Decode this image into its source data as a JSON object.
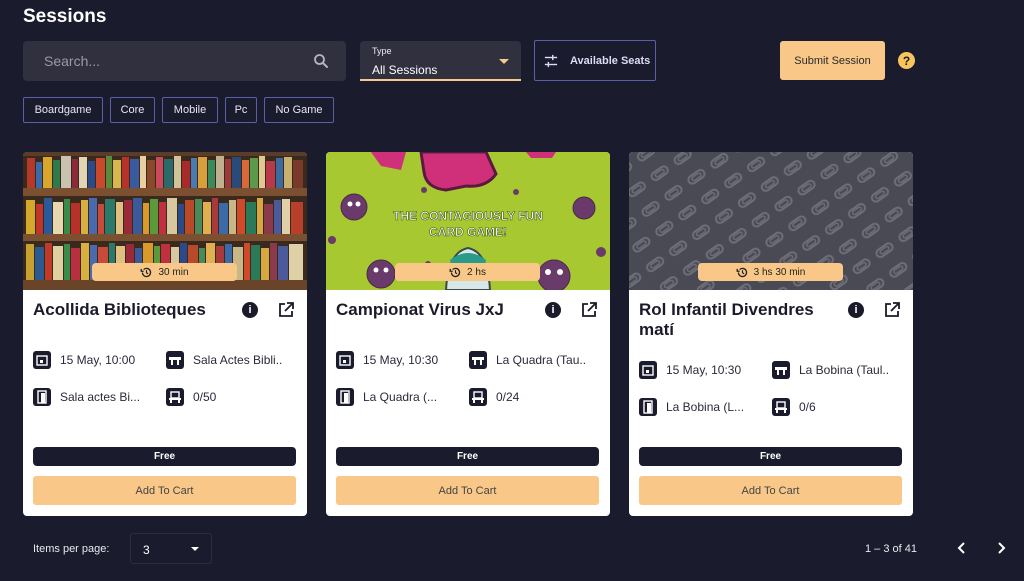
{
  "header": {
    "title": "Sessions"
  },
  "search": {
    "placeholder": "Search..."
  },
  "type_filter": {
    "label": "Type",
    "value": "All Sessions"
  },
  "seats_button": {
    "label": "Available Seats"
  },
  "submit_button": {
    "label": "Submit Session"
  },
  "help": {
    "glyph": "?"
  },
  "chips": [
    {
      "label": "Boardgame"
    },
    {
      "label": "Core"
    },
    {
      "label": "Mobile"
    },
    {
      "label": "Pc"
    },
    {
      "label": "No Game"
    }
  ],
  "cards": [
    {
      "image": "bookshelf-library",
      "duration": "30 min",
      "title": "Acollida Biblioteques",
      "date": "15 May, 10:00",
      "room": "Sala Actes Bibli...",
      "location": "Sala actes Bi...",
      "seats": "0/50",
      "price": "Free",
      "cart_label": "Add To Cart"
    },
    {
      "image": "virus-card-game",
      "image_text": "THE CONTAGIOUSLY FUN CARD GAME!",
      "duration": "2 hs",
      "title": "Campionat Virus JxJ",
      "date": "15 May, 10:30",
      "room": "La Quadra (Tau...",
      "location": "La Quadra (...",
      "seats": "0/24",
      "price": "Free",
      "cart_label": "Add To Cart"
    },
    {
      "image": "paperclip-pattern",
      "duration": "3 hs 30 min",
      "title": "Rol Infantil Divendres matí",
      "date": "15 May, 10:30",
      "room": "La Bobina (Taul...",
      "location": "La Bobina (L...",
      "seats": "0/6",
      "price": "Free",
      "cart_label": "Add To Cart"
    }
  ],
  "pagination": {
    "items_per_page_label": "Items per page:",
    "items_per_page": "3",
    "range": "1 – 3 of 41"
  },
  "colors": {
    "background": "#1b1b2e",
    "accent": "#f9c889",
    "outline": "#5b5fa8",
    "card": "#ffffff"
  }
}
